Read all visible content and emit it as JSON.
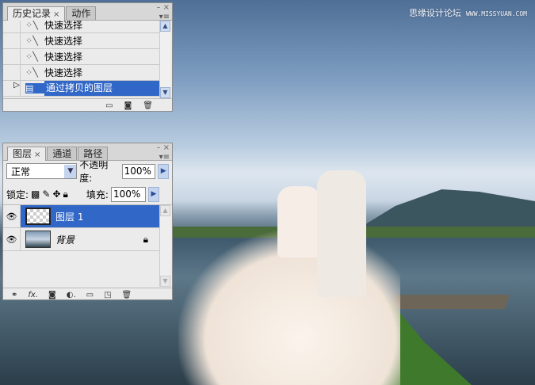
{
  "watermark": {
    "text": "思缘设计论坛",
    "url": "WWW.MISSYUAN.COM"
  },
  "history_panel": {
    "tabs": [
      {
        "label": "历史记录",
        "active": true
      },
      {
        "label": "动作",
        "active": false
      }
    ],
    "items": [
      {
        "label": "快速选择",
        "icon": "quick-selection-icon"
      },
      {
        "label": "快速选择",
        "icon": "quick-selection-icon"
      },
      {
        "label": "快速选择",
        "icon": "quick-selection-icon"
      },
      {
        "label": "快速选择",
        "icon": "quick-selection-icon"
      },
      {
        "label": "通过拷贝的图层",
        "icon": "layer-copy-icon",
        "selected": true
      }
    ],
    "footer_icons": [
      "new-document-icon",
      "snapshot-icon",
      "trash-icon"
    ]
  },
  "layers_panel": {
    "tabs": [
      {
        "label": "图层",
        "active": true
      },
      {
        "label": "通道",
        "active": false
      },
      {
        "label": "路径",
        "active": false
      }
    ],
    "blend_mode": "正常",
    "opacity_label": "不透明度:",
    "opacity": "100%",
    "lock_label": "锁定:",
    "fill_label": "填充:",
    "fill": "100%",
    "layers": [
      {
        "name": "图层 1",
        "visible": true,
        "selected": true
      },
      {
        "name": "背景",
        "visible": true,
        "locked": true
      }
    ],
    "footer_icons": [
      "link-icon",
      "fx-icon",
      "mask-icon",
      "adjustment-icon",
      "group-icon",
      "new-layer-icon",
      "trash-icon"
    ]
  },
  "colors": {
    "selection": "#3167c7",
    "panel": "#ebebeb"
  }
}
